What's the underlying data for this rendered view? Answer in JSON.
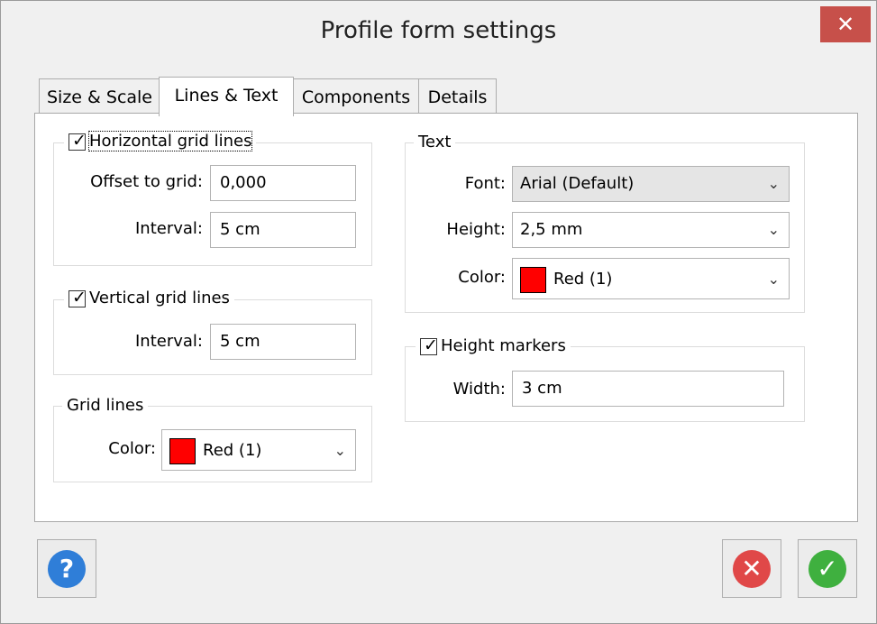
{
  "window": {
    "title": "Profile form settings"
  },
  "tabs": [
    {
      "label": "Size & Scale",
      "active": false
    },
    {
      "label": "Lines & Text",
      "active": true
    },
    {
      "label": "Components",
      "active": false
    },
    {
      "label": "Details",
      "active": false
    }
  ],
  "horizontal_grid": {
    "checkbox_label": "Horizontal grid lines",
    "checked": true,
    "offset_label": "Offset to grid:",
    "offset_value": "0,000",
    "interval_label": "Interval:",
    "interval_value": "5 cm"
  },
  "vertical_grid": {
    "checkbox_label": "Vertical grid lines",
    "checked": true,
    "interval_label": "Interval:",
    "interval_value": "5 cm"
  },
  "grid_lines": {
    "legend": "Grid lines",
    "color_label": "Color:",
    "color_value": "Red (1)",
    "color_hex": "#ff0000"
  },
  "text": {
    "legend": "Text",
    "font_label": "Font:",
    "font_value": "Arial (Default)",
    "height_label": "Height:",
    "height_value": "2,5 mm",
    "color_label": "Color:",
    "color_value": "Red (1)",
    "color_hex": "#ff0000"
  },
  "height_markers": {
    "checkbox_label": "Height markers",
    "checked": true,
    "width_label": "Width:",
    "width_value": "3 cm"
  },
  "buttons": {
    "help_icon": "question-icon",
    "cancel_icon": "cancel-icon",
    "ok_icon": "checkmark-icon"
  },
  "colors": {
    "close": "#c7504a",
    "help": "#2f7ed8",
    "cancel": "#e04848",
    "ok": "#3fb03f"
  }
}
